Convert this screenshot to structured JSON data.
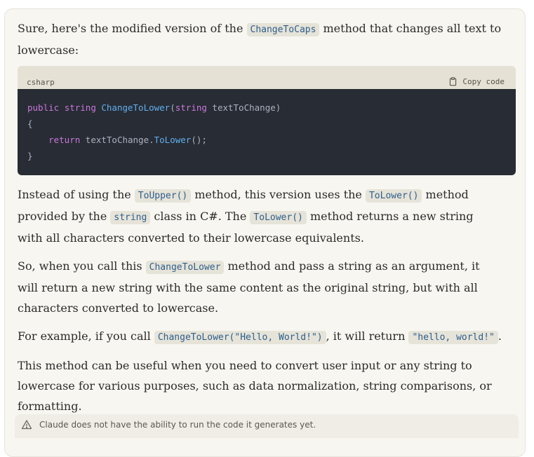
{
  "intro": {
    "before": "Sure, here's the modified version of the ",
    "code": "ChangeToCaps",
    "after": " method that changes all text to lowercase:"
  },
  "code_block": {
    "language": "csharp",
    "copy_label": "Copy code",
    "copy_icon": "clipboard-icon",
    "lines": {
      "l1_kw1": "public",
      "l1_kw2": "string",
      "l1_fn": "ChangeToLower",
      "l1_paren": "(",
      "l1_kw3": "string",
      "l1_rest": " textToChange)",
      "l2": "{",
      "l3_indent": "    ",
      "l3_kw": "return",
      "l3_mid": " textToChange.",
      "l3_fn": "ToLower",
      "l3_end": "();",
      "l4": "}"
    }
  },
  "para1": {
    "t1": "Instead of using the ",
    "c1": "ToUpper()",
    "t2": " method, this version uses the ",
    "c2": "ToLower()",
    "t3": " method provided by the ",
    "c3": "string",
    "t4": " class in C#. The ",
    "c4": "ToLower()",
    "t5": " method returns a new string with all characters converted to their lowercase equivalents."
  },
  "para2": {
    "t1": "So, when you call this ",
    "c1": "ChangeToLower",
    "t2": " method and pass a string as an argument, it will return a new string with the same content as the original string, but with all characters converted to lowercase."
  },
  "para3": {
    "t1": "For example, if you call ",
    "c1": "ChangeToLower(\"Hello, World!\")",
    "t2": ", it will return ",
    "c2": "\"hello, world!\"",
    "t3": "."
  },
  "para4": {
    "text": "This method can be useful when you need to convert user input or any string to lowercase for various purposes, such as data normalization, string comparisons, or formatting."
  },
  "notice": {
    "icon": "warning-icon",
    "text": "Claude does not have the ability to run the code it generates yet."
  }
}
